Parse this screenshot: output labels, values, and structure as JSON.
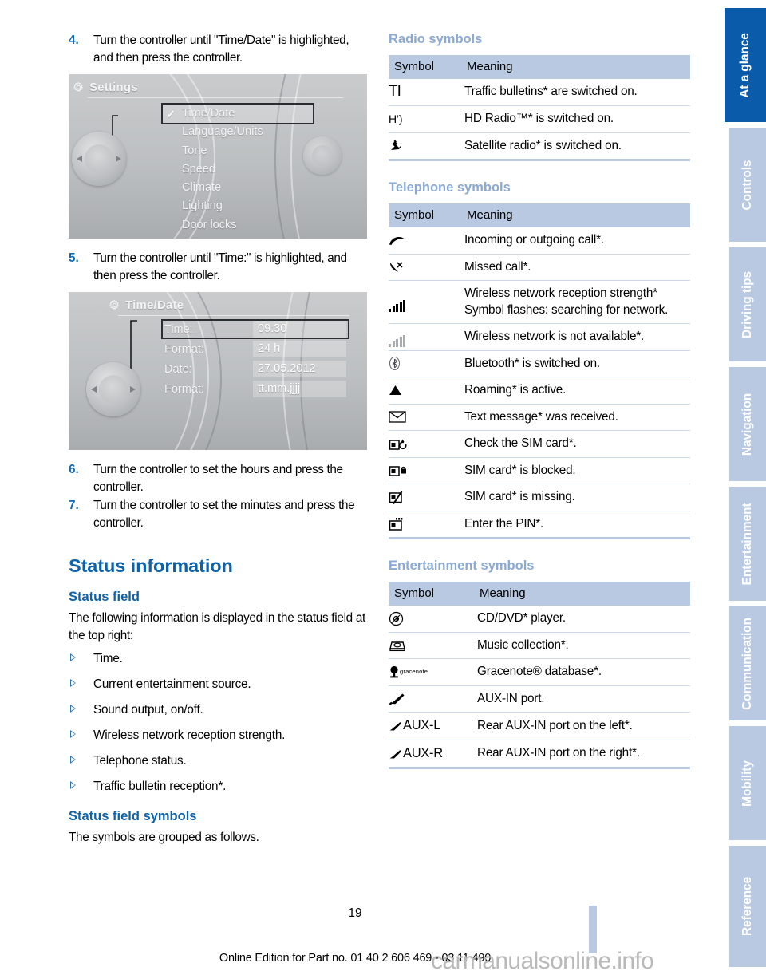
{
  "steps_a": [
    {
      "num": "4.",
      "text": "Turn the controller until \"Time/Date\" is highlighted, and then press the controller."
    }
  ],
  "steps_b": [
    {
      "num": "5.",
      "text": "Turn the controller until \"Time:\" is highlighted, and then press the controller."
    }
  ],
  "steps_c": [
    {
      "num": "6.",
      "text": "Turn the controller to set the hours and press the controller."
    },
    {
      "num": "7.",
      "text": "Turn the controller to set the minutes and press the controller."
    }
  ],
  "screen_settings": {
    "title": "Settings",
    "gear_icon": "gear-icon",
    "items": [
      {
        "label": "Time/Date",
        "selected": true,
        "checked": true
      },
      {
        "label": "Language/Units",
        "selected": false,
        "checked": false
      },
      {
        "label": "Tone",
        "selected": false,
        "checked": false
      },
      {
        "label": "Speed",
        "selected": false,
        "checked": false
      },
      {
        "label": "Climate",
        "selected": false,
        "checked": false
      },
      {
        "label": "Lighting",
        "selected": false,
        "checked": false
      },
      {
        "label": "Door locks",
        "selected": false,
        "checked": false
      }
    ]
  },
  "screen_timedate": {
    "title": "Time/Date",
    "gear_icon": "gear-icon",
    "rows": [
      {
        "label": "Time:",
        "value": "09:30",
        "selected": true
      },
      {
        "label": "Format:",
        "value": "24 h",
        "selected": false
      },
      {
        "label": "Date:",
        "value": "27.05.2012",
        "selected": false
      },
      {
        "label": "Format:",
        "value": "tt.mm.jjjj",
        "selected": false
      }
    ]
  },
  "status_information": {
    "heading": "Status information",
    "status_field": {
      "heading": "Status field",
      "intro": "The following information is displayed in the status field at the top right:",
      "items": [
        "Time.",
        "Current entertainment source.",
        "Sound output, on/off.",
        "Wireless network reception strength.",
        "Telephone status.",
        "Traffic bulletin reception*."
      ]
    },
    "status_field_symbols": {
      "heading": "Status field symbols",
      "intro": "The symbols are grouped as follows."
    }
  },
  "tables": {
    "radio": {
      "heading": "Radio symbols",
      "columns": [
        "Symbol",
        "Meaning"
      ],
      "rows": [
        {
          "symbol": "TI",
          "icon": "traffic-bulletin-icon",
          "meaning": "Traffic bulletins* are switched on."
        },
        {
          "symbol": "HD",
          "icon": "hd-radio-icon",
          "meaning": "HD Radio™* is switched on."
        },
        {
          "symbol": "satellite",
          "icon": "satellite-radio-icon",
          "meaning": "Satellite radio* is switched on."
        }
      ]
    },
    "telephone": {
      "heading": "Telephone symbols",
      "columns": [
        "Symbol",
        "Meaning"
      ],
      "rows": [
        {
          "icon": "phone-handset-icon",
          "meaning": "Incoming or outgoing call*."
        },
        {
          "icon": "missed-call-icon",
          "meaning": "Missed call*."
        },
        {
          "icon": "signal-bars-icon",
          "meaning": "Wireless network reception strength* Symbol flashes: searching for network."
        },
        {
          "icon": "signal-bars-grey-icon",
          "meaning": "Wireless network is not available*."
        },
        {
          "icon": "bluetooth-icon",
          "meaning": "Bluetooth* is switched on."
        },
        {
          "icon": "roaming-triangle-icon",
          "meaning": "Roaming* is active."
        },
        {
          "icon": "envelope-icon",
          "meaning": "Text message* was received."
        },
        {
          "icon": "sim-check-icon",
          "meaning": "Check the SIM card*."
        },
        {
          "icon": "sim-locked-icon",
          "meaning": "SIM card* is blocked."
        },
        {
          "icon": "sim-missing-icon",
          "meaning": "SIM card* is missing."
        },
        {
          "icon": "sim-pin-icon",
          "meaning": "Enter the PIN*."
        }
      ]
    },
    "entertainment": {
      "heading": "Entertainment symbols",
      "columns": [
        "Symbol",
        "Meaning"
      ],
      "rows": [
        {
          "icon": "cd-dvd-icon",
          "label": "",
          "meaning": "CD/DVD* player."
        },
        {
          "icon": "music-collection-icon",
          "label": "",
          "meaning": "Music collection*."
        },
        {
          "icon": "gracenote-icon",
          "label": "gracenote",
          "meaning": "Gracenote® database*."
        },
        {
          "icon": "aux-plug-icon",
          "label": "",
          "meaning": "AUX-IN port."
        },
        {
          "icon": "aux-plug-icon",
          "label": "AUX-L",
          "meaning": "Rear AUX-IN port on the left*."
        },
        {
          "icon": "aux-plug-icon",
          "label": "AUX-R",
          "meaning": "Rear AUX-IN port on the right*."
        }
      ]
    }
  },
  "sidebar": {
    "tabs": [
      {
        "label": "At a glance",
        "active": true
      },
      {
        "label": "Controls",
        "active": false
      },
      {
        "label": "Driving tips",
        "active": false
      },
      {
        "label": "Navigation",
        "active": false
      },
      {
        "label": "Entertainment",
        "active": false
      },
      {
        "label": "Communication",
        "active": false
      },
      {
        "label": "Mobility",
        "active": false
      },
      {
        "label": "Reference",
        "active": false
      }
    ]
  },
  "footer": {
    "page_number": "19",
    "edition_line": "Online Edition for Part no. 01 40 2 606 469 - 03 11 490",
    "watermark": "carmanualsonline.info"
  },
  "colors": {
    "heading_dark_blue": "#0c62ab",
    "heading_light_blue": "#8aa9d4",
    "table_header_blue": "#b9c9e2",
    "tab_active_blue": "#0a5ba9",
    "tab_inactive_blue": "#b9c9e2",
    "row_rule": "#ccd8ea"
  }
}
